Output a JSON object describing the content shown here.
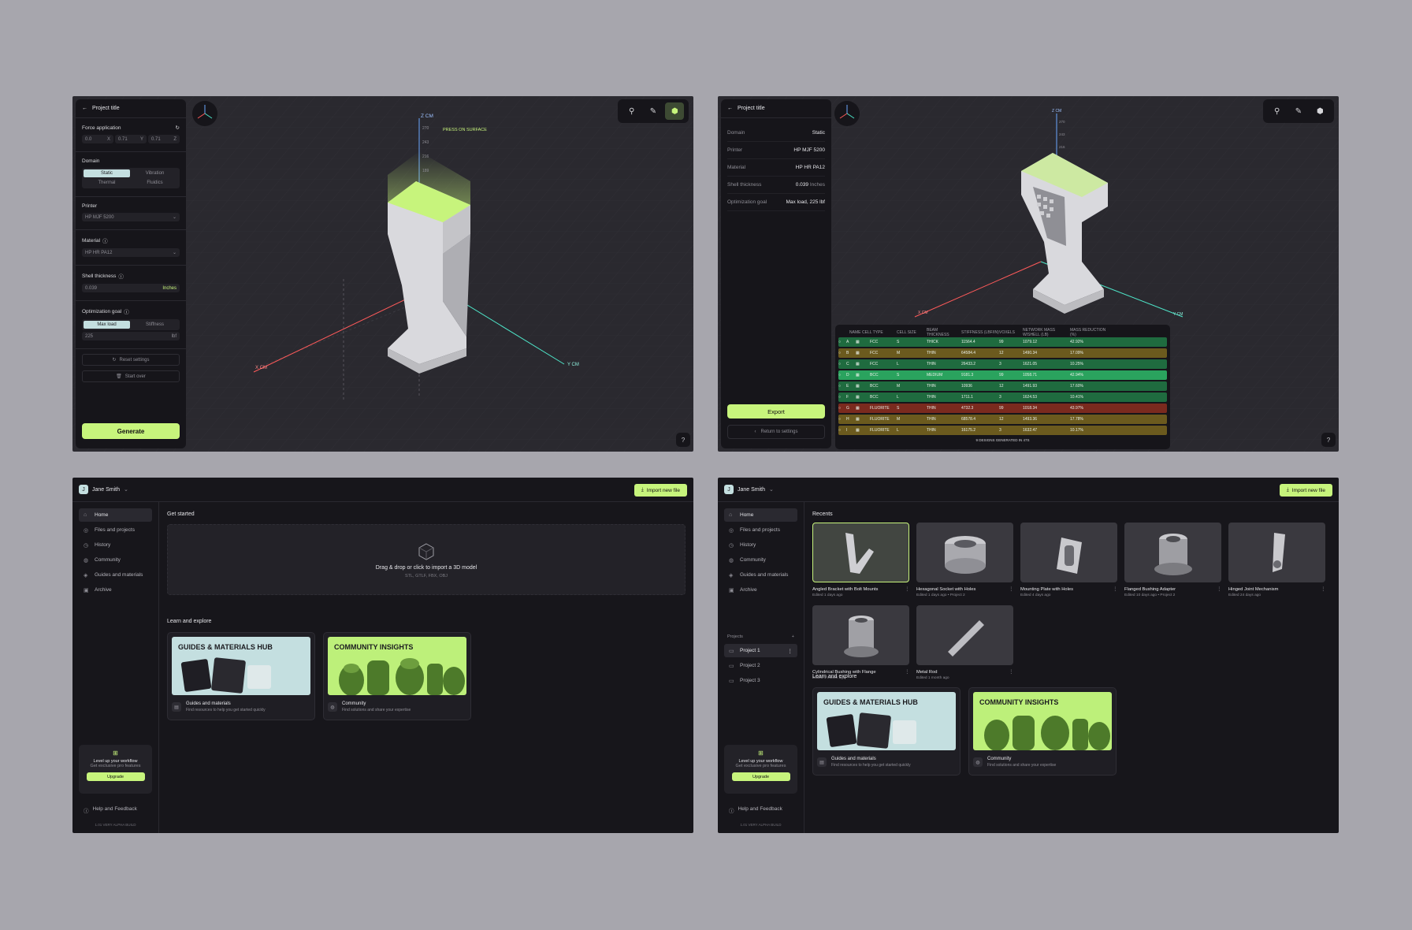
{
  "colors": {
    "accent": "#c7f47c",
    "panel": "#16151a",
    "viewport": "#2a292f",
    "teal": "#c4dfe0"
  },
  "editor": {
    "back_icon": "arrow-left-icon",
    "project_title": "Project title",
    "force_label": "Force application",
    "force": {
      "x_val": "0.0",
      "x_axis": "X",
      "y_val": "0.71",
      "y_axis": "Y",
      "z_val": "0.71",
      "z_axis": "Z"
    },
    "domain_label": "Domain",
    "domain_options": [
      "Static",
      "Vibration",
      "Thermal",
      "Fluidics"
    ],
    "printer_label": "Printer",
    "printer_value": "HP MJF 5200",
    "material_label": "Material",
    "material_value": "HP HR PA12",
    "shell_label": "Shell thickness",
    "shell_value": "0.039",
    "shell_unit": "Inches",
    "goal_label": "Optimization goal",
    "goal_options": [
      "Max load",
      "Stiffness"
    ],
    "goal_value": "225",
    "goal_unit": "lbf",
    "reset_label": "Reset settings",
    "start_over_label": "Start over",
    "generate_label": "Generate",
    "axis_z": "Z CM",
    "axis_x": "X CM",
    "axis_y": "Y CM",
    "z_ticks": [
      "270",
      "243",
      "216",
      "189"
    ],
    "press_label": "PRESS ON SURFACE",
    "help": "?"
  },
  "results": {
    "project_title": "Project title",
    "summary": [
      {
        "k": "Domain",
        "v": "Static"
      },
      {
        "k": "Printer",
        "v": "HP MJF 5200"
      },
      {
        "k": "Material",
        "v": "HP HR PA12"
      },
      {
        "k": "Shell thickness",
        "v": "0.039",
        "unit": "Inches"
      },
      {
        "k": "Optimization goal",
        "v": "Max load, 225 lbf"
      }
    ],
    "export_label": "Export",
    "return_label": "Return to settings",
    "axis_z": "Z CM",
    "axis_x": "X CM",
    "axis_y": "Y CM",
    "z_ticks": [
      "270",
      "243",
      "216"
    ],
    "columns": [
      "NAME",
      "CELL TYPE",
      "CELL SIZE",
      "BEAM THICKNESS",
      "STIFFNESS (LBF/IN)",
      "VOXELS",
      "NETWORK MASS W/SHELL (LB)",
      "MASS REDUCTION (%)"
    ],
    "rows": [
      {
        "name": "A",
        "type": "FCC",
        "size": "S",
        "beam": "THICK",
        "stiff": "11564.4",
        "vox": "99",
        "mass": "1079.12",
        "red": "42.92%",
        "color": "#1f6b3f"
      },
      {
        "name": "B",
        "type": "FCC",
        "size": "M",
        "beam": "THIN",
        "stiff": "64584.4",
        "vox": "12",
        "mass": "1490.34",
        "red": "17.09%",
        "color": "#6b5a1e"
      },
      {
        "name": "C",
        "type": "FCC",
        "size": "L",
        "beam": "THIN",
        "stiff": "26433.2",
        "vox": "3",
        "mass": "1621.05",
        "red": "10.25%",
        "color": "#1f6b3f"
      },
      {
        "name": "D",
        "type": "BCC",
        "size": "S",
        "beam": "MEDIUM",
        "stiff": "9181.3",
        "vox": "99",
        "mass": "1058.71",
        "red": "42.94%",
        "color": "#2aa35e"
      },
      {
        "name": "E",
        "type": "BCC",
        "size": "M",
        "beam": "THIN",
        "stiff": "10936",
        "vox": "12",
        "mass": "1491.93",
        "red": "17.60%",
        "color": "#1f6b3f"
      },
      {
        "name": "F",
        "type": "BCC",
        "size": "L",
        "beam": "THIN",
        "stiff": "1711.1",
        "vox": "3",
        "mass": "1624.53",
        "red": "10.41%",
        "color": "#1f6b3f"
      },
      {
        "name": "G",
        "type": "FLUORITE",
        "size": "S",
        "beam": "THIN",
        "stiff": "4732.3",
        "vox": "99",
        "mass": "1018.34",
        "red": "43.97%",
        "color": "#7a2a1e"
      },
      {
        "name": "H",
        "type": "FLUORITE",
        "size": "M",
        "beam": "THIN",
        "stiff": "68578.4",
        "vox": "12",
        "mass": "1493.36",
        "red": "17.78%",
        "color": "#6b5a1e"
      },
      {
        "name": "I",
        "type": "FLUORITE",
        "size": "L",
        "beam": "THIN",
        "stiff": "16175.2",
        "vox": "3",
        "mass": "1632.47",
        "red": "10.17%",
        "color": "#6b5a1e"
      }
    ],
    "footer": "9 DESIGNS GENERATED IN 47S"
  },
  "home": {
    "user_initial": "J",
    "user_name": "Jane Smith",
    "import_label": "Import new file",
    "nav": [
      {
        "label": "Home",
        "icon": "⌂"
      },
      {
        "label": "Files and projects",
        "icon": "◎"
      },
      {
        "label": "History",
        "icon": "◷"
      },
      {
        "label": "Community",
        "icon": "◍"
      },
      {
        "label": "Guides and materials",
        "icon": "◈"
      },
      {
        "label": "Archive",
        "icon": "▣"
      }
    ],
    "upgrade_title": "Level up your workflow",
    "upgrade_sub": "Get exclusive pro features",
    "upgrade_btn": "Upgrade",
    "help_label": "Help and Feedback",
    "version": "1.01 VERY ALPHA BUILD",
    "get_started": "Get started",
    "drop_title": "Drag & drop or click to import a 3D model",
    "drop_formats": "STL, GTLF, FBX, OBJ",
    "learn": "Learn and explore",
    "cards": [
      {
        "banner": "GUIDES & MATERIALS HUB",
        "title": "Guides and materials",
        "sub": "Find resources to help you get started quickly"
      },
      {
        "banner": "COMMUNITY INSIGHTS",
        "title": "Community",
        "sub": "Find solutions and share your expertise"
      }
    ]
  },
  "recents": {
    "title": "Recents",
    "projects_label": "Projects",
    "projects": [
      "Project 1",
      "Project 2",
      "Project 3"
    ],
    "items": [
      {
        "name": "Angled Bracket with Bolt Mounts",
        "meta": "Edited 1 days ago"
      },
      {
        "name": "Hexagonal Socket with Holes",
        "meta": "Edited 1 days ago  •  Project 2"
      },
      {
        "name": "Mounting Plate with Holes",
        "meta": "Edited 4 days ago"
      },
      {
        "name": "Flanged Bushing Adapter",
        "meta": "Edited 10 days ago  •  Project 2"
      },
      {
        "name": "Hinged Joint Mechanism",
        "meta": "Edited 24 days ago"
      },
      {
        "name": "Cylindrical Bushing with Flange",
        "meta": "Edited 1 month ago"
      },
      {
        "name": "Metal Rod",
        "meta": "Edited 1 month ago"
      }
    ]
  }
}
